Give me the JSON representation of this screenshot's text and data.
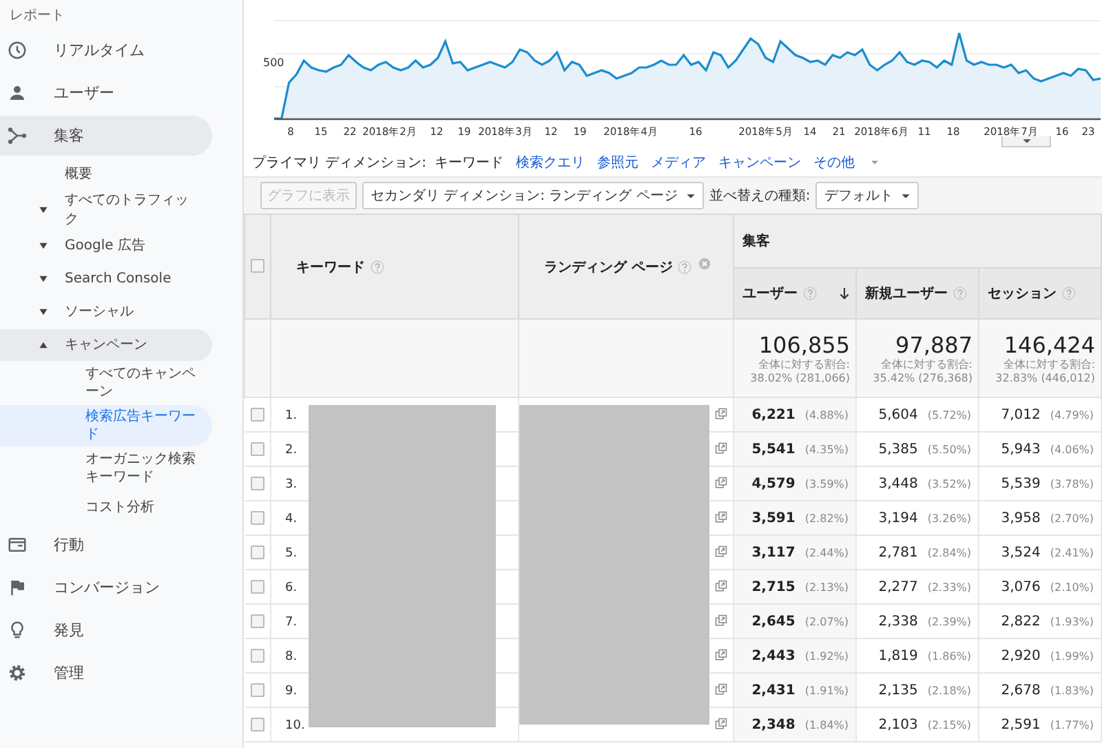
{
  "sidebar": {
    "section_label": "レポート",
    "items": [
      {
        "label": "リアルタイム",
        "expanded": false
      },
      {
        "label": "ユーザー",
        "expanded": false
      },
      {
        "label": "集客",
        "expanded": true,
        "children": [
          {
            "label": "概要"
          },
          {
            "label": "すべてのトラフィック",
            "expanded": false
          },
          {
            "label": "Google 広告",
            "expanded": false
          },
          {
            "label": "Search Console",
            "expanded": false
          },
          {
            "label": "ソーシャル",
            "expanded": false
          },
          {
            "label": "キャンペーン",
            "expanded": true,
            "children": [
              {
                "label": "すべてのキャンペーン",
                "selected": false
              },
              {
                "label": "検索広告キーワード",
                "selected": true
              },
              {
                "label": "オーガニック検索キーワード",
                "selected": false
              },
              {
                "label": "コスト分析",
                "selected": false
              }
            ]
          }
        ]
      },
      {
        "label": "行動",
        "expanded": false
      },
      {
        "label": "コンバージョン",
        "expanded": false
      },
      {
        "label": "発見",
        "expanded": false
      },
      {
        "label": "管理",
        "expanded": false
      }
    ]
  },
  "chart": {
    "y_tick": "500",
    "x_labels": [
      "8",
      "15",
      "22",
      "2018年2月",
      "12",
      "19",
      "2018年3月",
      "12",
      "19",
      "2018年4月",
      "16",
      "2018年5月",
      "14",
      "21",
      "2018年6月",
      "11",
      "18",
      "2018年7月",
      "16",
      "23"
    ]
  },
  "primary_dimension": {
    "label": "プライマリ ディメンション:",
    "options": [
      {
        "label": "キーワード",
        "selected": true
      },
      {
        "label": "検索クエリ",
        "selected": false
      },
      {
        "label": "参照元",
        "selected": false
      },
      {
        "label": "メディア",
        "selected": false
      },
      {
        "label": "キャンペーン",
        "selected": false
      },
      {
        "label": "その他",
        "selected": false
      }
    ]
  },
  "toolbar": {
    "plot_button": {
      "label": "グラフに表示",
      "disabled": true
    },
    "secondary_dimension": "セカンダリ ディメンション: ランディング ページ",
    "sort_label": "並べ替えの種類:",
    "sort_value": "デフォルト"
  },
  "table": {
    "select_all_checked": false,
    "columns": [
      {
        "label": "キーワード"
      },
      {
        "label": "ランディング ページ"
      }
    ],
    "group": "集客",
    "metrics": [
      {
        "label": "ユーザー",
        "sorted": true
      },
      {
        "label": "新規ユーザー",
        "sorted": false
      },
      {
        "label": "セッション",
        "sorted": false
      }
    ],
    "totals": [
      {
        "value": "106,855",
        "caption": "全体に対する割合:",
        "share": "38.02% (281,066)"
      },
      {
        "value": "97,887",
        "caption": "全体に対する割合:",
        "share": "35.42% (276,368)"
      },
      {
        "value": "146,424",
        "caption": "全体に対する割合:",
        "share": "32.83% (446,012)"
      }
    ],
    "rows": [
      {
        "index": "1.",
        "checked": false,
        "values": [
          [
            "6,221",
            "(4.88%)"
          ],
          [
            "5,604",
            "(5.72%)"
          ],
          [
            "7,012",
            "(4.79%)"
          ]
        ]
      },
      {
        "index": "2.",
        "checked": false,
        "values": [
          [
            "5,541",
            "(4.35%)"
          ],
          [
            "5,385",
            "(5.50%)"
          ],
          [
            "5,943",
            "(4.06%)"
          ]
        ]
      },
      {
        "index": "3.",
        "checked": false,
        "values": [
          [
            "4,579",
            "(3.59%)"
          ],
          [
            "3,448",
            "(3.52%)"
          ],
          [
            "5,539",
            "(3.78%)"
          ]
        ]
      },
      {
        "index": "4.",
        "checked": false,
        "values": [
          [
            "3,591",
            "(2.82%)"
          ],
          [
            "3,194",
            "(3.26%)"
          ],
          [
            "3,958",
            "(2.70%)"
          ]
        ]
      },
      {
        "index": "5.",
        "checked": false,
        "values": [
          [
            "3,117",
            "(2.44%)"
          ],
          [
            "2,781",
            "(2.84%)"
          ],
          [
            "3,524",
            "(2.41%)"
          ]
        ]
      },
      {
        "index": "6.",
        "checked": false,
        "values": [
          [
            "2,715",
            "(2.13%)"
          ],
          [
            "2,277",
            "(2.33%)"
          ],
          [
            "3,076",
            "(2.10%)"
          ]
        ]
      },
      {
        "index": "7.",
        "checked": false,
        "values": [
          [
            "2,645",
            "(2.07%)"
          ],
          [
            "2,338",
            "(2.39%)"
          ],
          [
            "2,822",
            "(1.93%)"
          ]
        ]
      },
      {
        "index": "8.",
        "checked": false,
        "values": [
          [
            "2,443",
            "(1.92%)"
          ],
          [
            "1,819",
            "(1.86%)"
          ],
          [
            "2,920",
            "(1.99%)"
          ]
        ]
      },
      {
        "index": "9.",
        "checked": false,
        "values": [
          [
            "2,431",
            "(1.91%)"
          ],
          [
            "2,135",
            "(2.18%)"
          ],
          [
            "2,678",
            "(1.83%)"
          ]
        ]
      },
      {
        "index": "10.",
        "checked": false,
        "values": [
          [
            "2,348",
            "(1.84%)"
          ],
          [
            "2,103",
            "(2.15%)"
          ],
          [
            "2,591",
            "(1.77%)"
          ]
        ]
      }
    ]
  }
}
